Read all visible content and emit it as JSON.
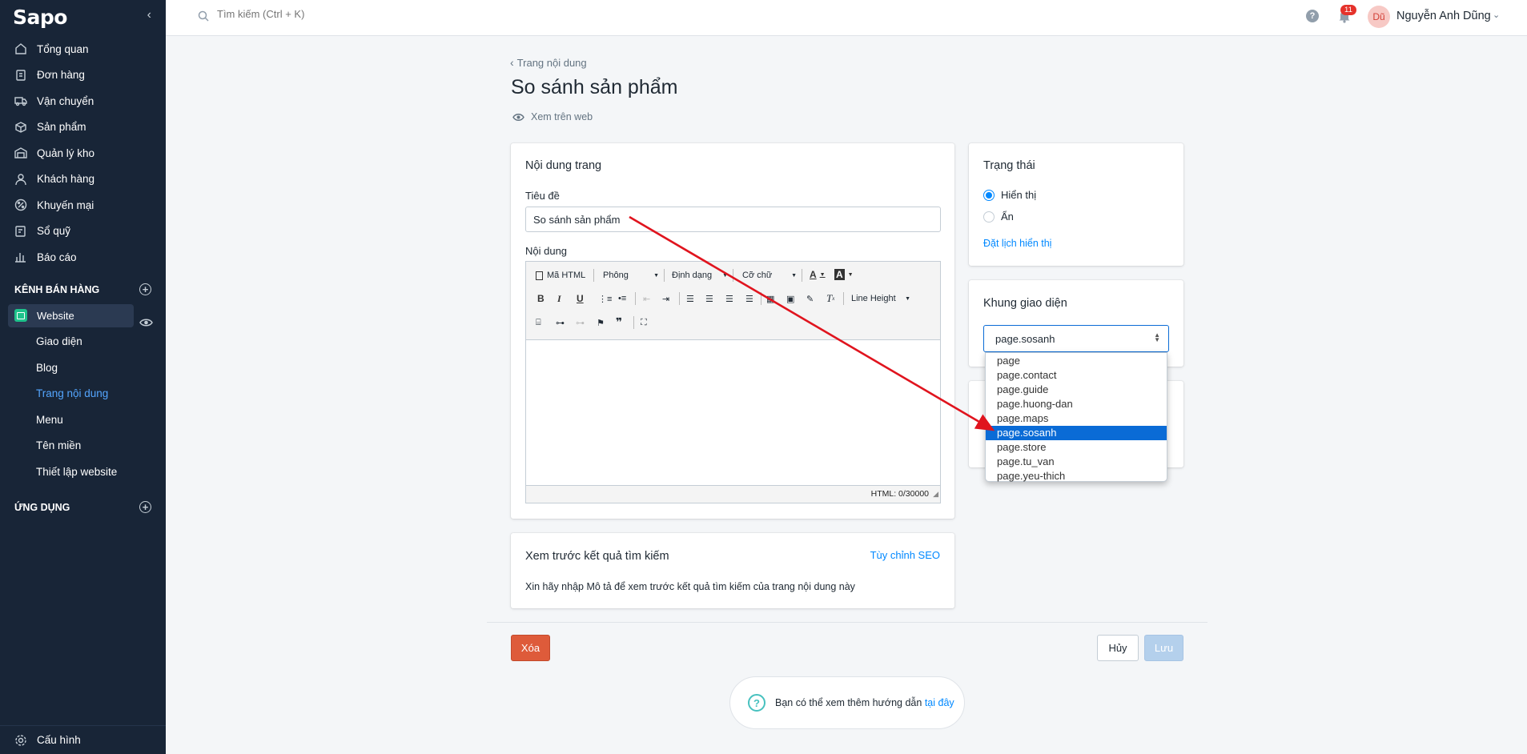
{
  "sidebar": {
    "logo": "Sapo",
    "items": [
      {
        "label": "Tổng quan"
      },
      {
        "label": "Đơn hàng"
      },
      {
        "label": "Vận chuyển"
      },
      {
        "label": "Sản phẩm"
      },
      {
        "label": "Quản lý kho"
      },
      {
        "label": "Khách hàng"
      },
      {
        "label": "Khuyến mại"
      },
      {
        "label": "Sổ quỹ"
      },
      {
        "label": "Báo cáo"
      }
    ],
    "sales_channels": "KÊNH BÁN HÀNG",
    "website": "Website",
    "website_sub": [
      {
        "label": "Giao diện"
      },
      {
        "label": "Blog"
      },
      {
        "label": "Trang nội dung"
      },
      {
        "label": "Menu"
      },
      {
        "label": "Tên miền"
      },
      {
        "label": "Thiết lập website"
      }
    ],
    "apps": "ỨNG DỤNG",
    "config": "Cấu hình"
  },
  "topbar": {
    "search_placeholder": "Tìm kiếm (Ctrl + K)",
    "help": "?",
    "notification_count": "11",
    "avatar_initials": "Dũ",
    "user_name": "Nguyễn Anh Dũng"
  },
  "page": {
    "back_label": "Trang nội dung",
    "title": "So sánh sản phẩm",
    "view_on_web": "Xem trên web"
  },
  "content_card": {
    "title": "Nội dung trang",
    "title_label": "Tiêu đề",
    "title_value": "So sánh sản phẩm",
    "content_label": "Nội dung",
    "toolbar": {
      "html": "Mã HTML",
      "font": "Phông",
      "format": "Định dạng",
      "size": "Cỡ chữ",
      "line_height": "Line Height",
      "bold": "B",
      "italic": "I",
      "underline": "U",
      "font_color": "A",
      "bg_color": "A",
      "clear": "T",
      "quote": "❞"
    },
    "html_count": "HTML: 0/30000"
  },
  "status_card": {
    "title": "Trạng thái",
    "visible": "Hiển thị",
    "hidden": "Ẩn",
    "schedule": "Đặt lịch hiển thị"
  },
  "template_card": {
    "title": "Khung giao diện",
    "selected": "page.sosanh",
    "options": [
      "page",
      "page.contact",
      "page.guide",
      "page.huong-dan",
      "page.maps",
      "page.sosanh",
      "page.store",
      "page.tu_van",
      "page.yeu-thich"
    ],
    "selected_index": 5
  },
  "seo_card": {
    "title": "Xem trước kết quả tìm kiếm",
    "customize": "Tùy chỉnh SEO",
    "hint": "Xin hãy nhập Mô tả để xem trước kết quả tìm kiếm của trang nội dung này"
  },
  "actions": {
    "delete": "Xóa",
    "cancel": "Hủy",
    "save": "Lưu"
  },
  "help": {
    "text": "Bạn có thể xem thêm hướng dẫn ",
    "link": "tại đây"
  },
  "colors": {
    "sidebar_bg": "#182537",
    "accent": "#0088ff",
    "annotation_arrow": "#e0141e"
  }
}
